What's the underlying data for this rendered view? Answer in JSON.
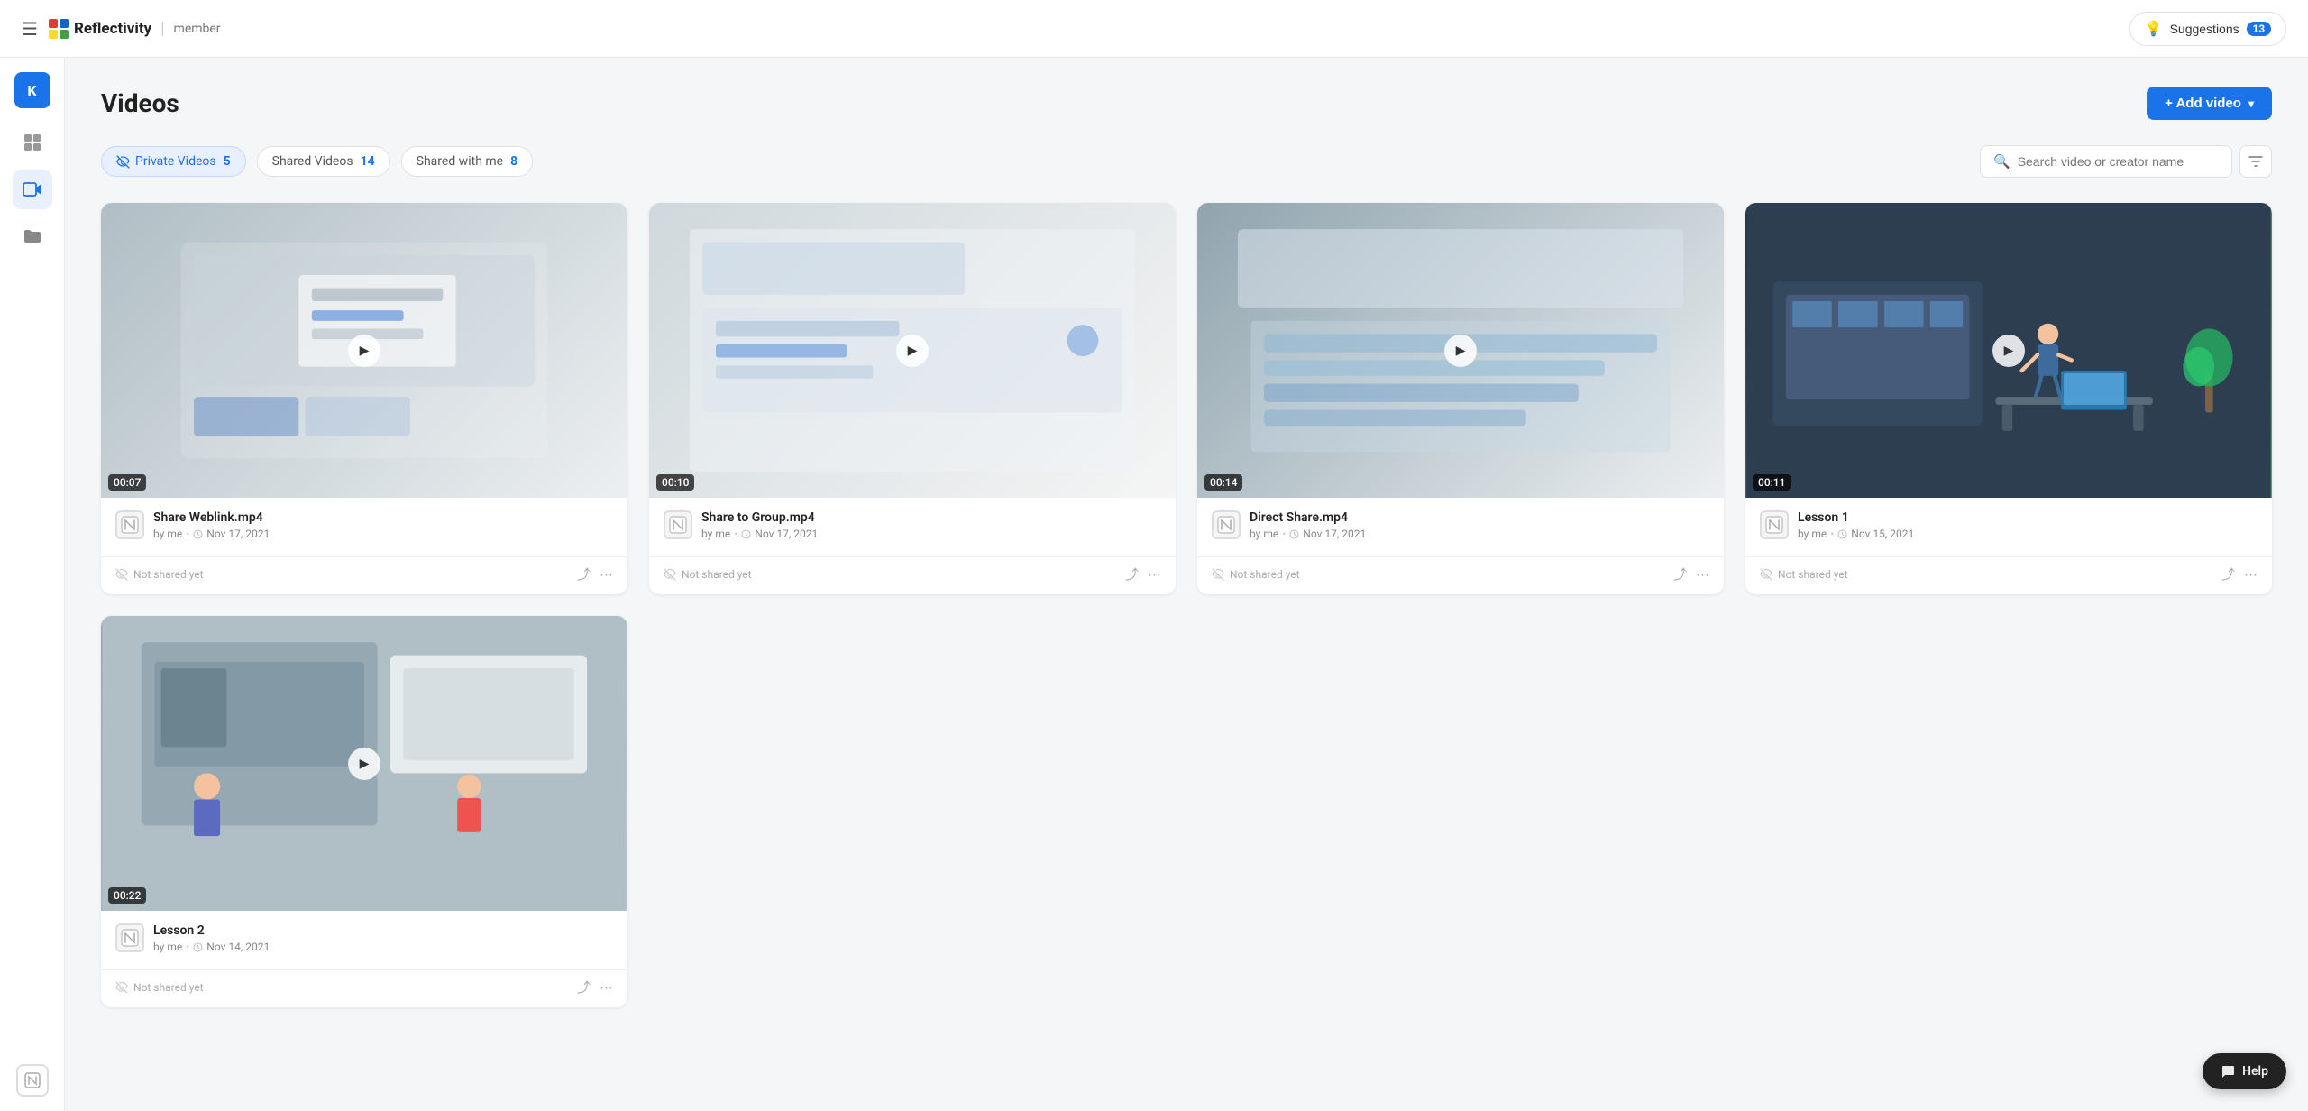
{
  "navbar": {
    "brand": "Reflectivity",
    "role": "member",
    "suggestions_label": "Suggestions",
    "suggestions_count": "13"
  },
  "sidebar": {
    "avatar_label": "K",
    "items": [
      {
        "id": "dashboard",
        "icon": "▦",
        "label": "Dashboard",
        "active": false
      },
      {
        "id": "videos",
        "icon": "🎬",
        "label": "Videos",
        "active": true
      },
      {
        "id": "folders",
        "icon": "📁",
        "label": "Folders",
        "active": false
      }
    ]
  },
  "page": {
    "title": "Videos",
    "add_button": "+ Add video"
  },
  "tabs": [
    {
      "id": "private",
      "label": "Private Videos",
      "count": "5",
      "active": true,
      "icon": "👁"
    },
    {
      "id": "shared",
      "label": "Shared Videos",
      "count": "14",
      "active": false,
      "icon": ""
    },
    {
      "id": "shared_with_me",
      "label": "Shared with me",
      "count": "8",
      "active": false,
      "icon": ""
    }
  ],
  "search": {
    "placeholder": "Search video or creator name"
  },
  "videos": [
    {
      "id": 1,
      "title": "Share Weblink.mp4",
      "creator": "by me",
      "date": "Nov 17, 2021",
      "duration": "00:07",
      "share_status": "Not shared yet",
      "thumb_class": "thumb-1"
    },
    {
      "id": 2,
      "title": "Share to Group.mp4",
      "creator": "by me",
      "date": "Nov 17, 2021",
      "duration": "00:10",
      "share_status": "Not shared yet",
      "thumb_class": "thumb-2"
    },
    {
      "id": 3,
      "title": "Direct Share.mp4",
      "creator": "by me",
      "date": "Nov 17, 2021",
      "duration": "00:14",
      "share_status": "Not shared yet",
      "thumb_class": "thumb-3"
    },
    {
      "id": 4,
      "title": "Lesson 1",
      "creator": "by me",
      "date": "Nov 15, 2021",
      "duration": "00:11",
      "share_status": "Not shared yet",
      "thumb_class": "thumb-4"
    },
    {
      "id": 5,
      "title": "Lesson 2",
      "creator": "by me",
      "date": "Nov 14, 2021",
      "duration": "00:22",
      "share_status": "Not shared yet",
      "thumb_class": "thumb-5"
    }
  ],
  "help": {
    "label": "Help"
  }
}
